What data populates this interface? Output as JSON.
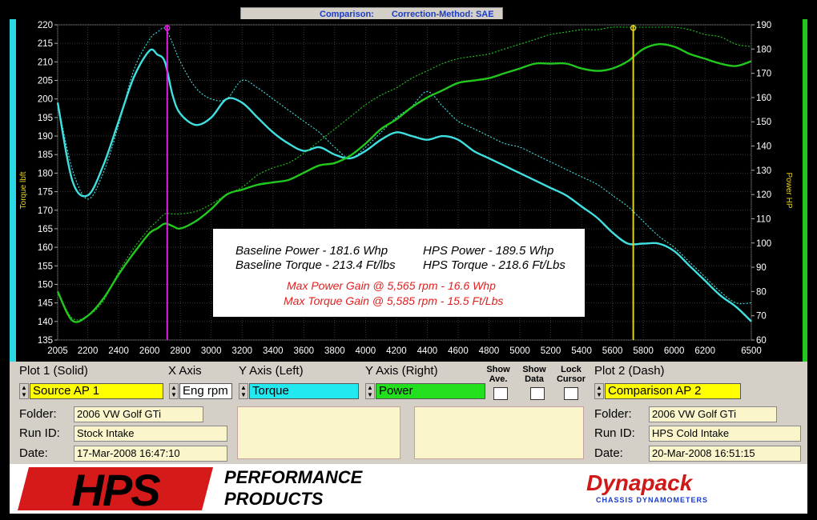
{
  "window": {
    "title_left": "Comparison:",
    "title_right": "Correction-Method: SAE"
  },
  "chart_data": {
    "type": "line",
    "x": [
      2005,
      2100,
      2200,
      2300,
      2400,
      2500,
      2600,
      2650,
      2700,
      2750,
      2800,
      2900,
      3000,
      3100,
      3200,
      3300,
      3400,
      3500,
      3600,
      3700,
      3800,
      3900,
      4000,
      4100,
      4200,
      4300,
      4400,
      4500,
      4600,
      4700,
      4800,
      4900,
      5000,
      5100,
      5200,
      5300,
      5400,
      5500,
      5600,
      5700,
      5800,
      5900,
      6000,
      6100,
      6200,
      6300,
      6400,
      6500
    ],
    "xlim": [
      2005,
      6500
    ],
    "xticks": [
      2005,
      2200,
      2400,
      2600,
      2800,
      3000,
      3200,
      3400,
      3600,
      3800,
      4000,
      4200,
      4400,
      4600,
      4800,
      5000,
      5200,
      5400,
      5600,
      5800,
      6000,
      6200,
      6500
    ],
    "ylabel_left": "Torque lbft",
    "ylabel_right": "Power HP",
    "ylim_left": [
      135,
      220
    ],
    "ylim_right": [
      60,
      190
    ],
    "yticks_left": [
      135,
      140,
      145,
      150,
      155,
      160,
      165,
      170,
      175,
      180,
      185,
      190,
      195,
      200,
      205,
      210,
      215,
      220
    ],
    "yticks_right": [
      60,
      70,
      80,
      90,
      100,
      110,
      120,
      130,
      140,
      150,
      160,
      170,
      180,
      190
    ],
    "series": [
      {
        "axis": "left",
        "style": "solid",
        "color": "#40e0e0",
        "values": [
          199,
          178,
          174,
          182,
          194,
          206,
          213,
          212,
          210,
          201,
          196,
          193,
          195,
          200,
          199,
          195,
          191,
          188,
          186,
          187,
          185,
          184,
          186,
          189,
          191,
          190,
          189,
          190,
          189,
          186,
          184,
          182,
          180,
          178,
          176,
          174,
          171,
          168,
          164,
          161,
          161,
          161,
          159,
          155,
          151,
          147,
          144,
          140
        ]
      },
      {
        "axis": "left",
        "style": "dash",
        "color": "#40e0e0",
        "values": [
          199,
          181,
          173,
          180,
          193,
          208,
          216,
          218,
          219,
          215,
          210,
          203,
          200,
          200,
          205,
          203,
          200,
          197,
          194,
          191,
          187,
          184,
          187,
          191,
          195,
          198,
          202,
          198,
          194,
          192,
          190,
          188,
          187,
          185,
          183,
          181,
          179,
          177,
          174,
          171,
          167,
          163,
          160,
          156,
          152,
          148,
          145,
          145
        ]
      },
      {
        "axis": "right",
        "style": "solid",
        "color": "#22c81e",
        "values": [
          80,
          68,
          70,
          77,
          87,
          96,
          104,
          106,
          108,
          107,
          106,
          109,
          114,
          120,
          122,
          124,
          125,
          126,
          129,
          132,
          133,
          136,
          141,
          147,
          151,
          156,
          160,
          163,
          166,
          167,
          168,
          170,
          172,
          174,
          174,
          174,
          172,
          171,
          172,
          175,
          180,
          182,
          181,
          178,
          176,
          174,
          173,
          175
        ]
      },
      {
        "axis": "right",
        "style": "dash",
        "color": "#22c81e",
        "values": [
          80,
          69,
          70,
          76,
          88,
          98,
          106,
          109,
          112,
          112,
          112,
          113,
          116,
          120,
          123,
          128,
          131,
          133,
          137,
          142,
          147,
          152,
          157,
          161,
          164,
          168,
          171,
          174,
          176,
          177,
          178,
          180,
          182,
          184,
          186,
          187,
          188,
          188,
          189,
          189,
          189,
          189,
          189,
          188,
          186,
          185,
          182,
          181
        ]
      }
    ],
    "markers": [
      {
        "x": 2715,
        "color": "#e020e0"
      },
      {
        "x": 5735,
        "color": "#e0d020"
      }
    ],
    "annotations": {
      "line1a": "Baseline Power - 181.6 Whp",
      "line1b": "HPS Power - 189.5 Whp",
      "line2a": "Baseline Torque - 213.4 Ft/lbs",
      "line2b": "HPS Torque - 218.6 Ft/Lbs",
      "line3": "Max Power Gain @ 5,565 rpm - 16.6 Whp",
      "line4": "Max Torque Gain @ 5,585 rpm - 15.5 Ft/Lbs"
    },
    "grid": true
  },
  "panel": {
    "plot1_label": "Plot 1 (Solid)",
    "xaxis_label": "X Axis",
    "yleft_label": "Y Axis (Left)",
    "yright_label": "Y Axis (Right)",
    "show_ave_label": "Show Ave.",
    "show_data_label": "Show Data",
    "lock_cursor_label": "Lock Cursor",
    "plot2_label": "Plot 2 (Dash)",
    "source1_value": "Source AP 1",
    "xaxis_value": "Eng rpm",
    "yleft_value": "Torque",
    "yright_value": "Power",
    "source2_value": "Comparison AP 2",
    "folder_label": "Folder:",
    "runid_label": "Run ID:",
    "date_label": "Date:",
    "plot1_folder": "2006 VW Golf GTi",
    "plot1_runid": "Stock Intake",
    "plot1_date": "17-Mar-2008  16:47:10",
    "plot2_folder": "2006 VW Golf GTi",
    "plot2_runid": "HPS Cold Intake",
    "plot2_date": "20-Mar-2008  16:51:15",
    "colors": {
      "source": "#ffff00",
      "torque": "#22e8f0",
      "power": "#22e01e",
      "box": "#fbf5cc"
    }
  },
  "footer": {
    "logo_text": "HPS",
    "performance": "PERFORMANCE",
    "products": "PRODUCTS",
    "dynapack": "Dynapack",
    "dynapack_sub": "CHASSIS DYNAMOMETERS"
  }
}
